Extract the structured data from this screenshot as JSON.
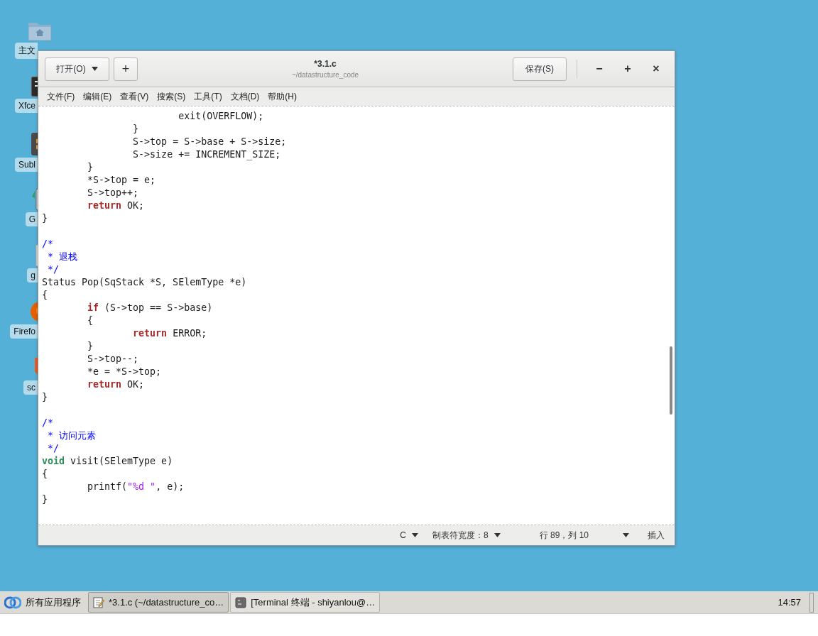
{
  "desktop_icons": [
    {
      "kind": "home",
      "label": "主文"
    },
    {
      "kind": "terminal",
      "label": "Xfce"
    },
    {
      "kind": "sublime",
      "label": "Subl"
    },
    {
      "kind": "editor",
      "label": "G"
    },
    {
      "kind": "text",
      "label": "g"
    },
    {
      "kind": "firefox",
      "label": "Firefo"
    },
    {
      "kind": "sc",
      "label": "sc"
    }
  ],
  "window": {
    "title": "*3.1.c",
    "subtitle": "~/datastructure_code",
    "open_button": "打开(O)",
    "new_button": "+",
    "save_button": "保存(S)",
    "controls": [
      "−",
      "+",
      "×"
    ]
  },
  "menu": [
    "文件(F)",
    "编辑(E)",
    "查看(V)",
    "搜索(S)",
    "工具(T)",
    "文档(D)",
    "帮助(H)"
  ],
  "code_blocks": [
    {
      "lines": [
        {
          "segments": [
            {
              "kind": "plain",
              "text": "\t\t\texit(OVERFLOW);"
            }
          ]
        },
        {
          "segments": [
            {
              "kind": "plain",
              "text": "\t\t}"
            }
          ]
        },
        {
          "segments": [
            {
              "kind": "plain",
              "text": "\t\tS->top = S->base + S->size;"
            }
          ]
        },
        {
          "segments": [
            {
              "kind": "plain",
              "text": "\t\tS->size += INCREMENT_SIZE;"
            }
          ]
        },
        {
          "segments": [
            {
              "kind": "plain",
              "text": "\t}"
            }
          ]
        },
        {
          "segments": [
            {
              "kind": "plain",
              "text": "\t*S->top = e;"
            }
          ]
        },
        {
          "segments": [
            {
              "kind": "plain",
              "text": "\tS->top++;"
            }
          ]
        },
        {
          "segments": [
            {
              "kind": "keyword",
              "text": "\treturn"
            },
            {
              "kind": "plain",
              "text": " OK;"
            }
          ]
        },
        {
          "segments": [
            {
              "kind": "plain",
              "text": "}"
            }
          ]
        }
      ]
    },
    {
      "lines": [
        {
          "segments": [
            {
              "kind": "comment",
              "text": "/*"
            }
          ]
        },
        {
          "segments": [
            {
              "kind": "comment",
              "text": " * 退栈"
            }
          ]
        },
        {
          "segments": [
            {
              "kind": "comment",
              "text": " */"
            }
          ]
        },
        {
          "segments": [
            {
              "kind": "plain",
              "text": "Status Pop(SqStack *S, SElemType *e)"
            }
          ]
        },
        {
          "segments": [
            {
              "kind": "plain",
              "text": "{"
            }
          ]
        },
        {
          "segments": [
            {
              "kind": "keyword",
              "text": "\tif"
            },
            {
              "kind": "plain",
              "text": " (S->top == S->base)"
            }
          ]
        },
        {
          "segments": [
            {
              "kind": "plain",
              "text": "\t{"
            }
          ]
        },
        {
          "segments": [
            {
              "kind": "keyword",
              "text": "\t\treturn"
            },
            {
              "kind": "plain",
              "text": " ERROR;"
            }
          ]
        },
        {
          "segments": [
            {
              "kind": "plain",
              "text": "\t}"
            }
          ]
        },
        {
          "segments": [
            {
              "kind": "plain",
              "text": "\tS->top--;"
            }
          ]
        },
        {
          "segments": [
            {
              "kind": "plain",
              "text": "\t*e = *S->top;"
            }
          ]
        },
        {
          "segments": [
            {
              "kind": "keyword",
              "text": "\treturn"
            },
            {
              "kind": "plain",
              "text": " OK;"
            }
          ]
        },
        {
          "segments": [
            {
              "kind": "plain",
              "text": "}"
            }
          ]
        }
      ]
    },
    {
      "lines": [
        {
          "segments": [
            {
              "kind": "comment",
              "text": "/*"
            }
          ]
        },
        {
          "segments": [
            {
              "kind": "comment",
              "text": " * 访问元素"
            }
          ]
        },
        {
          "segments": [
            {
              "kind": "comment",
              "text": " */"
            }
          ]
        },
        {
          "segments": [
            {
              "kind": "type",
              "text": "void"
            },
            {
              "kind": "plain",
              "text": " visit(SElemType e)"
            }
          ]
        },
        {
          "segments": [
            {
              "kind": "plain",
              "text": "{"
            }
          ]
        },
        {
          "segments": [
            {
              "kind": "plain",
              "text": "\tprintf("
            },
            {
              "kind": "string",
              "text": "\"%d \""
            },
            {
              "kind": "plain",
              "text": ", e);"
            }
          ]
        },
        {
          "segments": [
            {
              "kind": "plain",
              "text": "}"
            }
          ]
        }
      ]
    }
  ],
  "status_bar": [
    {
      "kind": "dropdown",
      "label": "C"
    },
    {
      "kind": "dropdown",
      "label": "制表符宽度：8"
    },
    {
      "kind": "text",
      "label": "行 89，列 10"
    },
    {
      "kind": "dropdown"
    },
    {
      "kind": "text",
      "label": "插入"
    }
  ],
  "taskbar": {
    "start": "所有应用程序",
    "tasks": [
      {
        "kind": "editor",
        "label": "*3.1.c (~/datastructure_co…",
        "selected": true
      },
      {
        "kind": "terminal",
        "label": "[Terminal 终端 - shiyanlou@…",
        "selected": false
      }
    ],
    "clock": "14:57"
  }
}
